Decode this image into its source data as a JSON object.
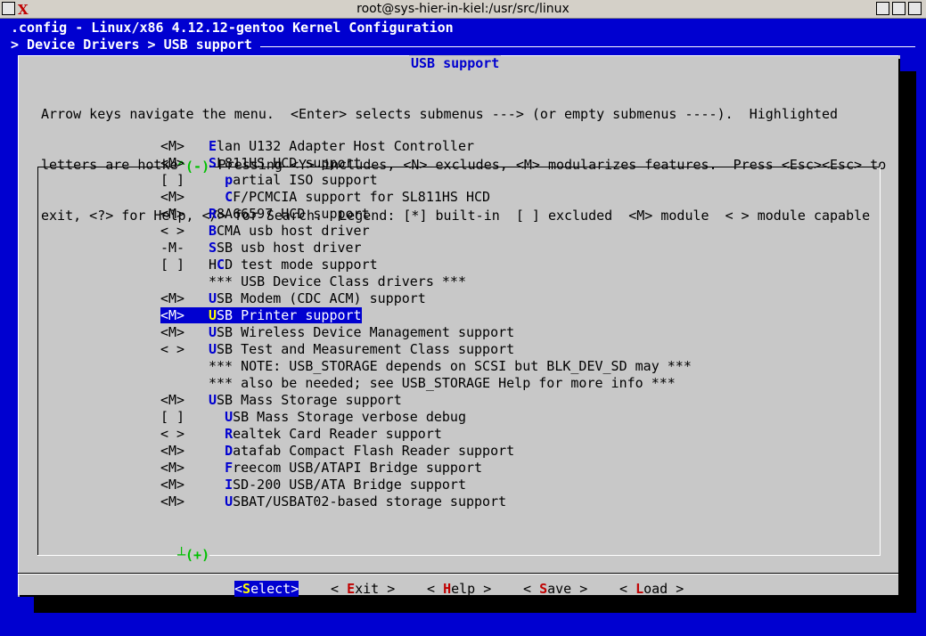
{
  "window": {
    "title": "root@sys-hier-in-kiel:/usr/src/linux"
  },
  "header": {
    "config_title": ".config - Linux/x86 4.12.12-gentoo Kernel Configuration",
    "breadcrumb": "> Device Drivers > USB support"
  },
  "dialog": {
    "title": "USB support",
    "help_lines": [
      "Arrow keys navigate the menu.  <Enter> selects submenus ---> (or empty submenus ----).  Highlighted",
      "letters are hotkeys.  Pressing <Y> includes, <N> excludes, <M> modularizes features.  Press <Esc><Esc> to",
      "exit, <?> for Help, </> for Search.  Legend: [*] built-in  [ ] excluded  <M> module  < > module capable"
    ],
    "scroll_up": "^(-)",
    "scroll_down": "┴(+)"
  },
  "menu": {
    "items": [
      {
        "state": "<M>",
        "indent": "",
        "hotkey": "E",
        "rest": "lan U132 Adapter Host Controller"
      },
      {
        "state": "<M>",
        "indent": "",
        "hotkey": "S",
        "rest": "L811HS HCD support"
      },
      {
        "state": "[ ]",
        "indent": "  ",
        "hotkey": "p",
        "rest": "artial ISO support"
      },
      {
        "state": "<M>",
        "indent": "  ",
        "hotkey": "C",
        "rest": "F/PCMCIA support for SL811HS HCD"
      },
      {
        "state": "<M>",
        "indent": "",
        "hotkey": "R",
        "rest": "8A66597 HCD support"
      },
      {
        "state": "< >",
        "indent": "",
        "hotkey": "B",
        "rest": "CMA usb host driver"
      },
      {
        "state": "-M-",
        "indent": "",
        "hotkey": "S",
        "rest": "SB usb host driver"
      },
      {
        "state": "[ ]",
        "indent": "H",
        "hotkey": "C",
        "rest": "D test mode support"
      },
      {
        "state": "",
        "indent": "",
        "hotkey": "",
        "rest": "*** USB Device Class drivers ***"
      },
      {
        "state": "<M>",
        "indent": "",
        "hotkey": "U",
        "rest": "SB Modem (CDC ACM) support"
      },
      {
        "state": "<M>",
        "indent": "",
        "hotkey": "U",
        "rest": "SB Printer support",
        "selected": true
      },
      {
        "state": "<M>",
        "indent": "",
        "hotkey": "U",
        "rest": "SB Wireless Device Management support"
      },
      {
        "state": "< >",
        "indent": "",
        "hotkey": "U",
        "rest": "SB Test and Measurement Class support"
      },
      {
        "state": "",
        "indent": "",
        "hotkey": "",
        "rest": "*** NOTE: USB_STORAGE depends on SCSI but BLK_DEV_SD may ***"
      },
      {
        "state": "",
        "indent": "",
        "hotkey": "",
        "rest": "*** also be needed; see USB_STORAGE Help for more info ***"
      },
      {
        "state": "<M>",
        "indent": "",
        "hotkey": "U",
        "rest": "SB Mass Storage support"
      },
      {
        "state": "[ ]",
        "indent": "  ",
        "hotkey": "U",
        "rest": "SB Mass Storage verbose debug"
      },
      {
        "state": "< >",
        "indent": "  ",
        "hotkey": "R",
        "rest": "ealtek Card Reader support"
      },
      {
        "state": "<M>",
        "indent": "  ",
        "hotkey": "D",
        "rest": "atafab Compact Flash Reader support"
      },
      {
        "state": "<M>",
        "indent": "  ",
        "hotkey": "F",
        "rest": "reecom USB/ATAPI Bridge support"
      },
      {
        "state": "<M>",
        "indent": "  ",
        "hotkey": "I",
        "rest": "SD-200 USB/ATA Bridge support"
      },
      {
        "state": "<M>",
        "indent": "  ",
        "hotkey": "U",
        "rest": "SBAT/USBAT02-based storage support"
      }
    ]
  },
  "buttons": [
    {
      "pre": "<",
      "hotkey": "S",
      "rest": "elect",
      "post": ">",
      "active": true
    },
    {
      "pre": "< ",
      "hotkey": "E",
      "rest": "xit",
      "post": " >"
    },
    {
      "pre": "< ",
      "hotkey": "H",
      "rest": "elp",
      "post": " >"
    },
    {
      "pre": "< ",
      "hotkey": "S",
      "rest": "ave",
      "post": " >"
    },
    {
      "pre": "< ",
      "hotkey": "L",
      "rest": "oad",
      "post": " >"
    }
  ],
  "colors": {
    "terminal_bg": "#0000d0",
    "dialog_bg": "#c8c8c8",
    "hotkey": "#0000d0",
    "button_hotkey": "#c00000",
    "scroll_arrow": "#00c000"
  }
}
